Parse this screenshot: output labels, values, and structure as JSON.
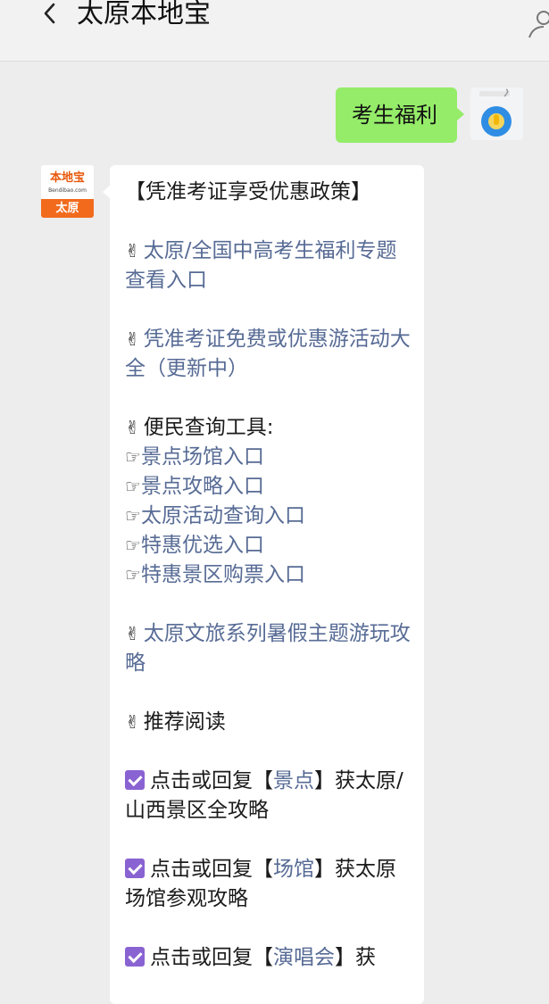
{
  "header": {
    "title": "太原本地宝",
    "back_icon": "chevron-left-icon",
    "profile_icon": "person-icon"
  },
  "user_message": {
    "text": "考生福利",
    "bubble_color": "#95ec69"
  },
  "bot_avatar": {
    "logo_name": "本地宝",
    "logo_domain": "Bendibao.com",
    "city": "太原",
    "brand_color": "#f26b1d"
  },
  "bot_message": {
    "heading": "【凭准考证享受优惠政策】",
    "item1": {
      "text": "太原/全国中高考生福利专题查看入口"
    },
    "item2": {
      "text": "凭准考证免费或优惠游活动大全（更新中）"
    },
    "tools": {
      "label": "便民查询工具:",
      "links": [
        "景点场馆入口",
        "景点攻略入口",
        "太原活动查询入口",
        "特惠优选入口",
        "特惠景区购票入口"
      ]
    },
    "item3": {
      "text": "太原文旅系列暑假主题游玩攻略"
    },
    "recommend": {
      "label": "推荐阅读"
    },
    "reply1": {
      "pre": "点击或回复【",
      "keyword": "景点",
      "post": "】获太原/山西景区全攻略"
    },
    "reply2": {
      "pre": "点击或回复【",
      "keyword": "场馆",
      "post": "】获太原场馆参观攻略"
    },
    "reply3": {
      "pre": "点击或回复【",
      "keyword": "演唱会",
      "post": "】获"
    },
    "link_color": "#576b95",
    "check_color": "#8a63d2"
  }
}
